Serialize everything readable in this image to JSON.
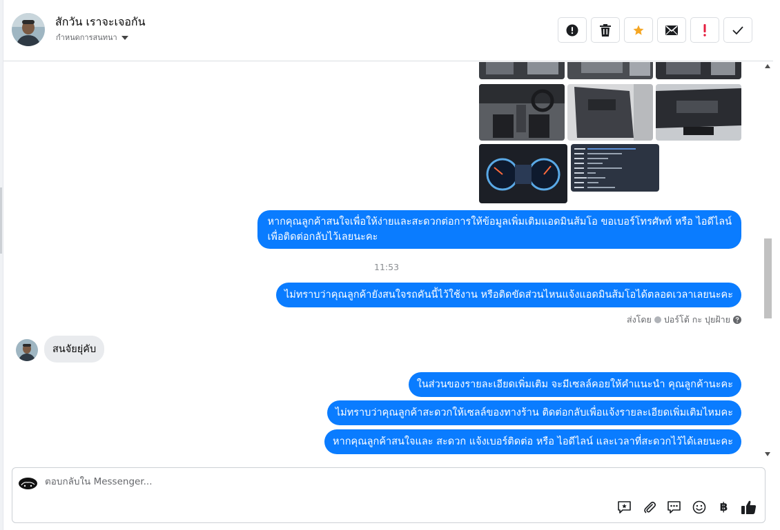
{
  "header": {
    "contact_name": "สักวัน เราจะเจอกัน",
    "assign_label": "กำหนดการสนทนา",
    "toolbar": [
      {
        "name": "spam-alert-button",
        "icon": "alert-circle-icon"
      },
      {
        "name": "delete-button",
        "icon": "trash-icon"
      },
      {
        "name": "star-button",
        "icon": "star-icon",
        "color": "#f5a623"
      },
      {
        "name": "mark-unread-button",
        "icon": "envelope-icon"
      },
      {
        "name": "important-button",
        "icon": "exclamation-icon",
        "color": "#e41e3f"
      },
      {
        "name": "done-button",
        "icon": "check-icon"
      }
    ]
  },
  "messages": {
    "out_1": "หากคุณลูกค้าสนใจเพื่อให้ง่ายและสะดวกต่อการให้ข้อมูลเพิ่มเติมแอดมินส้มโอ ขอเบอร์โทรศัพท์ หรือ ไอดีไลน์",
    "out_1_line2": "เพื่อติดต่อกลับไว้เลยนะคะ",
    "time": "11:53",
    "out_2": "ไม่ทราบว่าคุณลูกค้ายังสนใจรถคันนี้ไว้ใช้งาน หรือติดขัดส่วนไหนแจ้งแอดมินส้มโอได้ตลอดเวลาเลยนะคะ",
    "sent_by_label": "ส่งโดย",
    "sent_by_name": "ปอร์โต้ กะ ปุยฝ้าย",
    "in_1": "สนจัยยุ่คับ",
    "out_3": "ในส่วนของรายละเอียดเพิ่มเติม จะมีเซลล์คอยให้คำแนะนำ คุณลูกค้านะคะ",
    "out_4": "ไม่ทราบว่าคุณลูกค้าสะดวกให้เซลล์ของทางร้าน ติดต่อกลับเพื่อแจ้งรายละเอียดเพิ่มเติมไหมคะ",
    "out_5": "หากคุณลูกค้าสนใจและ สะดวก แจ้งเบอร์ติดต่อ หรือ ไอดีไลน์ และเวลาที่สะดวกไว้ได้เลยนะคะ"
  },
  "composer": {
    "placeholder": "ตอบกลับใน Messenger...",
    "baht_symbol": "฿",
    "icons": [
      "saved-reply-icon",
      "attachment-icon",
      "chat-bubbles-icon",
      "emoji-icon",
      "baht-payment-icon",
      "thumbs-up-icon"
    ]
  },
  "colors": {
    "outgoing_bubble": "#0a7cff",
    "incoming_bubble": "#e9ebee"
  }
}
